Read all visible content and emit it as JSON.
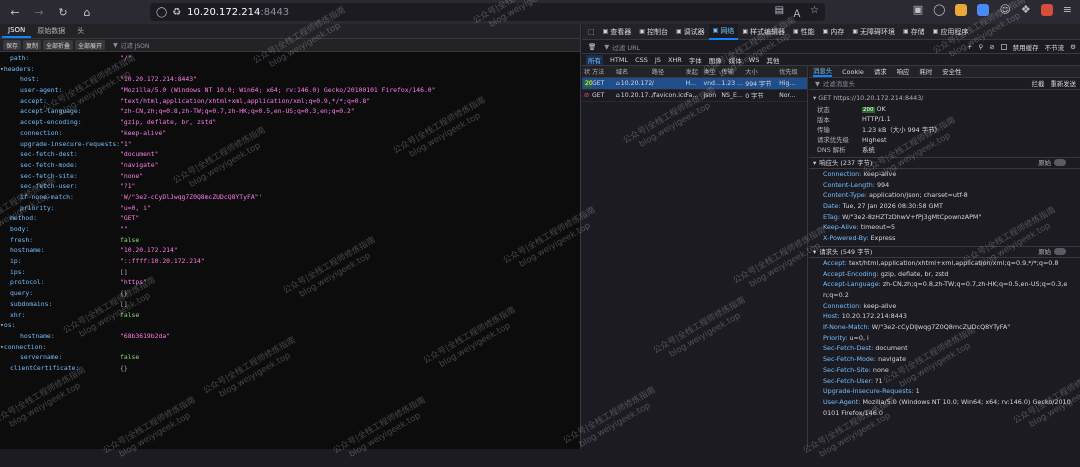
{
  "browser": {
    "url_host": "10.20.172.214",
    "url_port": ":8443"
  },
  "viewer": {
    "tabs": [
      "JSON",
      "原始数据",
      "头"
    ],
    "buttons": [
      "保存",
      "复制",
      "全部折叠",
      "全部展开"
    ],
    "filter_placeholder": "过滤 JSON",
    "lines": [
      {
        "key": "path:",
        "value": "\"/\"",
        "kind": "str",
        "indent": 1
      },
      {
        "key": "headers:",
        "value": "",
        "kind": "twisty",
        "indent": 0
      },
      {
        "key": "host:",
        "value": "\"10.20.172.214:8443\"",
        "kind": "str",
        "indent": 2
      },
      {
        "key": "user-agent:",
        "value": "\"Mozilla/5.0 (Windows NT 10.0; Win64; x64; rv:146.0) Gecko/20100101 Firefox/146.0\"",
        "kind": "str",
        "indent": 2
      },
      {
        "key": "accept:",
        "value": "\"text/html,application/xhtml+xml,application/xml;q=0.9,*/*;q=0.8\"",
        "kind": "str",
        "indent": 2
      },
      {
        "key": "accept-language:",
        "value": "\"zh-CN,zh;q=0.8,zh-TW;q=0.7,zh-HK;q=0.5,en-US;q=0.3,en;q=0.2\"",
        "kind": "str",
        "indent": 2
      },
      {
        "key": "accept-encoding:",
        "value": "\"gzip, deflate, br, zstd\"",
        "kind": "str",
        "indent": 2
      },
      {
        "key": "connection:",
        "value": "\"keep-alive\"",
        "kind": "str",
        "indent": 2
      },
      {
        "key": "upgrade-insecure-requests:",
        "value": "\"1\"",
        "kind": "str",
        "indent": 2
      },
      {
        "key": "sec-fetch-dest:",
        "value": "\"document\"",
        "kind": "str",
        "indent": 2
      },
      {
        "key": "sec-fetch-mode:",
        "value": "\"navigate\"",
        "kind": "str",
        "indent": 2
      },
      {
        "key": "sec-fetch-site:",
        "value": "\"none\"",
        "kind": "str",
        "indent": 2
      },
      {
        "key": "sec-fetch-user:",
        "value": "\"?1\"",
        "kind": "str",
        "indent": 2
      },
      {
        "key": "if-none-match:",
        "value": "'W/\"3e2-cCyDlJwqg7Z0Q8mcZUDcQ8YTyFA\"'",
        "kind": "str",
        "indent": 2
      },
      {
        "key": "priority:",
        "value": "\"u=0, i\"",
        "kind": "str",
        "indent": 2
      },
      {
        "key": "method:",
        "value": "\"GET\"",
        "kind": "str",
        "indent": 1
      },
      {
        "key": "body:",
        "value": "\"\"",
        "kind": "str",
        "indent": 1
      },
      {
        "key": "fresh:",
        "value": "false",
        "kind": "bool",
        "indent": 1
      },
      {
        "key": "hostname:",
        "value": "\"10.20.172.214\"",
        "kind": "str",
        "indent": 1
      },
      {
        "key": "ip:",
        "value": "\"::ffff:10.20.172.214\"",
        "kind": "str",
        "indent": 1
      },
      {
        "key": "ips:",
        "value": "[]",
        "kind": "obj",
        "indent": 1
      },
      {
        "key": "protocol:",
        "value": "\"https\"",
        "kind": "str",
        "indent": 1
      },
      {
        "key": "query:",
        "value": "{}",
        "kind": "obj",
        "indent": 1
      },
      {
        "key": "subdomains:",
        "value": "[]",
        "kind": "obj",
        "indent": 1
      },
      {
        "key": "xhr:",
        "value": "false",
        "kind": "bool",
        "indent": 1
      },
      {
        "key": "os:",
        "value": "",
        "kind": "twisty",
        "indent": 0
      },
      {
        "key": "hostname:",
        "value": "\"68b3619b2da\"",
        "kind": "str",
        "indent": 2
      },
      {
        "key": "connection:",
        "value": "",
        "kind": "twisty",
        "indent": 0
      },
      {
        "key": "servername:",
        "value": "false",
        "kind": "bool",
        "indent": 2
      },
      {
        "key": "clientCertificate:",
        "value": "{}",
        "kind": "obj",
        "indent": 1
      }
    ]
  },
  "devtools": {
    "tabs": [
      {
        "label": "查看器",
        "icon": "inspector-icon"
      },
      {
        "label": "控制台",
        "icon": "console-icon"
      },
      {
        "label": "调试器",
        "icon": "debugger-icon"
      },
      {
        "label": "网络",
        "icon": "network-icon",
        "active": true
      },
      {
        "label": "样式编辑器",
        "icon": "style-editor-icon"
      },
      {
        "label": "性能",
        "icon": "performance-icon"
      },
      {
        "label": "内存",
        "icon": "memory-icon"
      },
      {
        "label": "无障碍环境",
        "icon": "accessibility-icon"
      },
      {
        "label": "存储",
        "icon": "storage-icon"
      },
      {
        "label": "应用程序",
        "icon": "application-icon"
      }
    ],
    "filter_url_placeholder": "过滤 URL",
    "disable_cache": "禁用缓存",
    "throttle": "不节流",
    "type_filters": [
      "所有",
      "HTML",
      "CSS",
      "JS",
      "XHR",
      "字体",
      "图像",
      "媒体",
      "WS",
      "其他"
    ],
    "table_headers": [
      "状",
      "方法",
      "域名",
      "路径",
      "发起",
      "类型",
      "传输",
      "大小",
      "优先级"
    ],
    "requests": [
      {
        "status": "200",
        "method": "GET",
        "domain": "10.20.172.214:...",
        "path": "/",
        "initiator": "H...",
        "type": "vnd...",
        "transferred": "1.23 ...",
        "size": "994 字节",
        "priority": "Hig...",
        "selected": true
      },
      {
        "status": "",
        "method": "GET",
        "domain": "10.20.17...",
        "path": "/favicon.ico",
        "initiator": "Fa...",
        "type": "json",
        "transferred": "NS_E...",
        "size": "0 字节",
        "priority": "Nor...",
        "selected": false
      }
    ],
    "detail_tabs": [
      "消息头",
      "Cookie",
      "请求",
      "响应",
      "耗时",
      "安全性"
    ],
    "filter_headers_placeholder": "过滤消息头",
    "block_label": "拦截",
    "resend_label": "重新发送",
    "request_line": "GET https://10.20.172.214:8443/",
    "summary": [
      {
        "k": "状态",
        "v": "OK",
        "badge": "200"
      },
      {
        "k": "版本",
        "v": "HTTP/1.1"
      },
      {
        "k": "传输",
        "v": "1.23 kB（大小 994 字节）"
      },
      {
        "k": "请求优先级",
        "v": "Highest"
      },
      {
        "k": "DNS 解析",
        "v": "系统"
      }
    ],
    "response_section": "响应头 (237 字节)",
    "raw_label": "原始",
    "response_headers": [
      {
        "k": "Connection:",
        "v": "keep-alive"
      },
      {
        "k": "Content-Length:",
        "v": "994"
      },
      {
        "k": "Content-Type:",
        "v": "application/json; charset=utf-8"
      },
      {
        "k": "Date:",
        "v": "Tue, 27 Jan 2026 08:30:58 GMT"
      },
      {
        "k": "ETag:",
        "v": "W/\"3e2-8zHZTzDhwV+fPj3gMtCpownzAPM\""
      },
      {
        "k": "Keep-Alive:",
        "v": "timeout=5"
      },
      {
        "k": "X-Powered-By:",
        "v": "Express"
      }
    ],
    "request_section": "请求头 (549 字节)",
    "request_headers": [
      {
        "k": "Accept:",
        "v": "text/html,application/xhtml+xml,application/xml;q=0.9,*/*;q=0.8"
      },
      {
        "k": "Accept-Encoding:",
        "v": "gzip, deflate, br, zstd"
      },
      {
        "k": "Accept-Language:",
        "v": "zh-CN,zh;q=0.8,zh-TW;q=0.7,zh-HK;q=0.5,en-US;q=0.3,en;q=0.2"
      },
      {
        "k": "Connection:",
        "v": "keep-alive"
      },
      {
        "k": "Host:",
        "v": "10.20.172.214:8443"
      },
      {
        "k": "If-None-Match:",
        "v": "W/\"3e2-cCyDlJwqg7Z0Q8mcZUDcQ8YTyFA\""
      },
      {
        "k": "Priority:",
        "v": "u=0, i"
      },
      {
        "k": "Sec-Fetch-Dest:",
        "v": "document"
      },
      {
        "k": "Sec-Fetch-Mode:",
        "v": "navigate"
      },
      {
        "k": "Sec-Fetch-Site:",
        "v": "none"
      },
      {
        "k": "Sec-Fetch-User:",
        "v": "?1"
      },
      {
        "k": "Upgrade-Insecure-Requests:",
        "v": "1"
      },
      {
        "k": "User-Agent:",
        "v": "Mozilla/5.0 (Windows NT 10.0; Win64; x64; rv:146.0) Gecko/20100101 Firefox/146.0"
      }
    ]
  },
  "watermark": {
    "line1": "公众号|全栈工程师修炼指南",
    "line2": "blog.weiyigeek.top"
  }
}
